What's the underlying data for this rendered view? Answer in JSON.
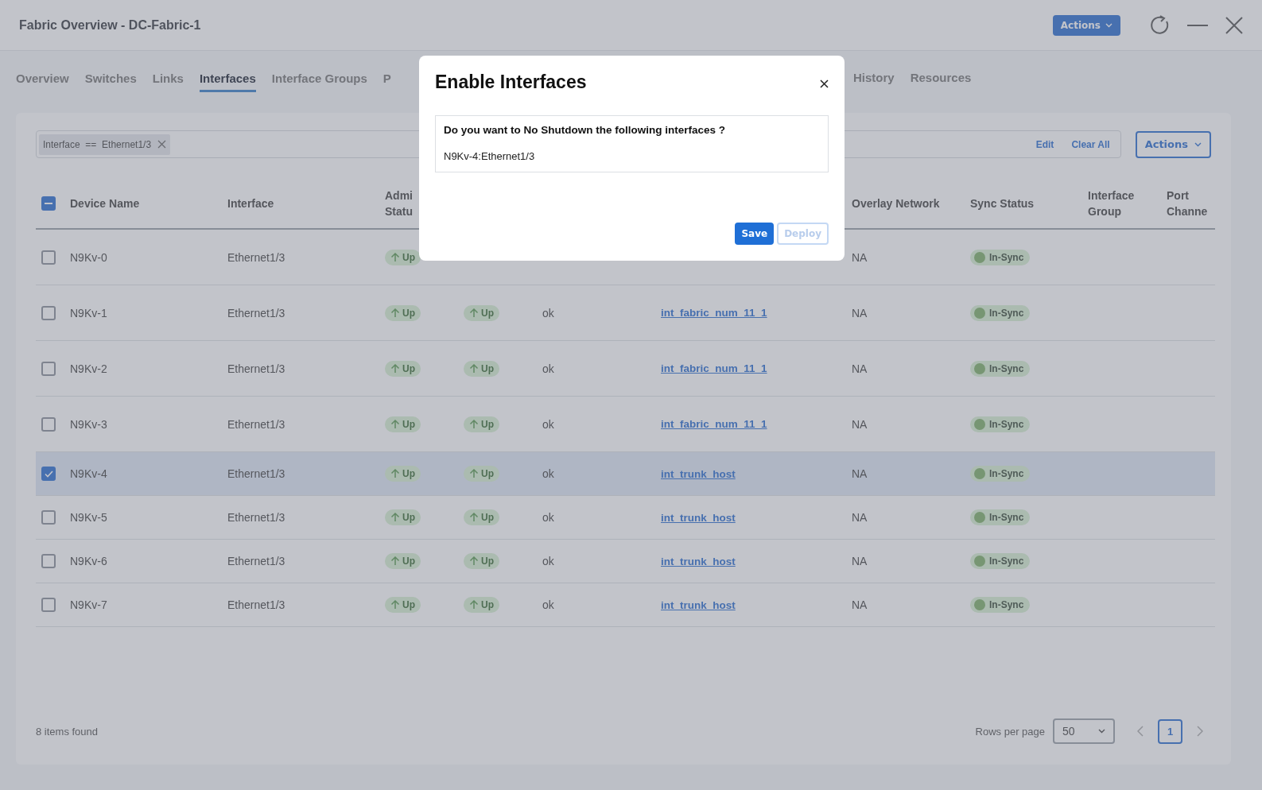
{
  "header": {
    "title": "Fabric Overview - DC-Fabric-1",
    "actions_button": "Actions"
  },
  "tabs": [
    {
      "label": "Overview",
      "selected": false
    },
    {
      "label": "Switches",
      "selected": false
    },
    {
      "label": "Links",
      "selected": false
    },
    {
      "label": "Interfaces",
      "selected": true
    },
    {
      "label": "Interface Groups",
      "selected": false
    },
    {
      "label": "P",
      "selected": false
    }
  ],
  "more_tabs": [
    {
      "label": "History",
      "selected": false
    },
    {
      "label": "Resources",
      "selected": false
    }
  ],
  "filter": {
    "chip": "Interface  ==  Ethernet1/3",
    "edit": "Edit",
    "clear_all": "Clear All",
    "actions_button": "Actions"
  },
  "table": {
    "select_all_indeterminate": true,
    "columns": [
      {
        "label": "Device Name"
      },
      {
        "label": "Interface"
      },
      {
        "label": "Admi Statu"
      },
      {},
      {},
      {},
      {
        "label": "Overlay Network"
      },
      {
        "label": "Sync Status"
      },
      {
        "label": "Interface Group"
      },
      {
        "label": "Port Channe"
      }
    ],
    "rows": [
      {
        "device": "N9Kv-0",
        "interface": "Ethernet1/3",
        "admin": "Up",
        "overlay": "NA",
        "sync": "In-Sync",
        "selected": false
      },
      {
        "device": "N9Kv-1",
        "interface": "Ethernet1/3",
        "admin": "Up",
        "oper": "Up",
        "reason": "ok",
        "policy": "int_fabric_num_11_1",
        "overlay": "NA",
        "sync": "In-Sync",
        "selected": false
      },
      {
        "device": "N9Kv-2",
        "interface": "Ethernet1/3",
        "admin": "Up",
        "oper": "Up",
        "reason": "ok",
        "policy": "int_fabric_num_11_1",
        "overlay": "NA",
        "sync": "In-Sync",
        "selected": false
      },
      {
        "device": "N9Kv-3",
        "interface": "Ethernet1/3",
        "admin": "Up",
        "oper": "Up",
        "reason": "ok",
        "policy": "int_fabric_num_11_1",
        "overlay": "NA",
        "sync": "In-Sync",
        "selected": false
      },
      {
        "device": "N9Kv-4",
        "interface": "Ethernet1/3",
        "admin": "Up",
        "oper": "Up",
        "reason": "ok",
        "policy": "int_trunk_host",
        "overlay": "NA",
        "sync": "In-Sync",
        "selected": true
      },
      {
        "device": "N9Kv-5",
        "interface": "Ethernet1/3",
        "admin": "Up",
        "oper": "Up",
        "reason": "ok",
        "policy": "int_trunk_host",
        "overlay": "NA",
        "sync": "In-Sync",
        "selected": false
      },
      {
        "device": "N9Kv-6",
        "interface": "Ethernet1/3",
        "admin": "Up",
        "oper": "Up",
        "reason": "ok",
        "policy": "int_trunk_host",
        "overlay": "NA",
        "sync": "In-Sync",
        "selected": false
      },
      {
        "device": "N9Kv-7",
        "interface": "Ethernet1/3",
        "admin": "Up",
        "oper": "Up",
        "reason": "ok",
        "policy": "int_trunk_host",
        "overlay": "NA",
        "sync": "In-Sync",
        "selected": false
      }
    ]
  },
  "footer": {
    "count": "8 items found",
    "rows_per_page_label": "Rows per page",
    "rows_per_page": "50",
    "page": "1"
  },
  "modal": {
    "title": "Enable Interfaces",
    "question": "Do you want to No Shutdown the following interfaces ?",
    "items": [
      "N9Kv-4:Ethernet1/3"
    ],
    "save": "Save",
    "deploy": "Deploy",
    "deploy_disabled": true
  }
}
